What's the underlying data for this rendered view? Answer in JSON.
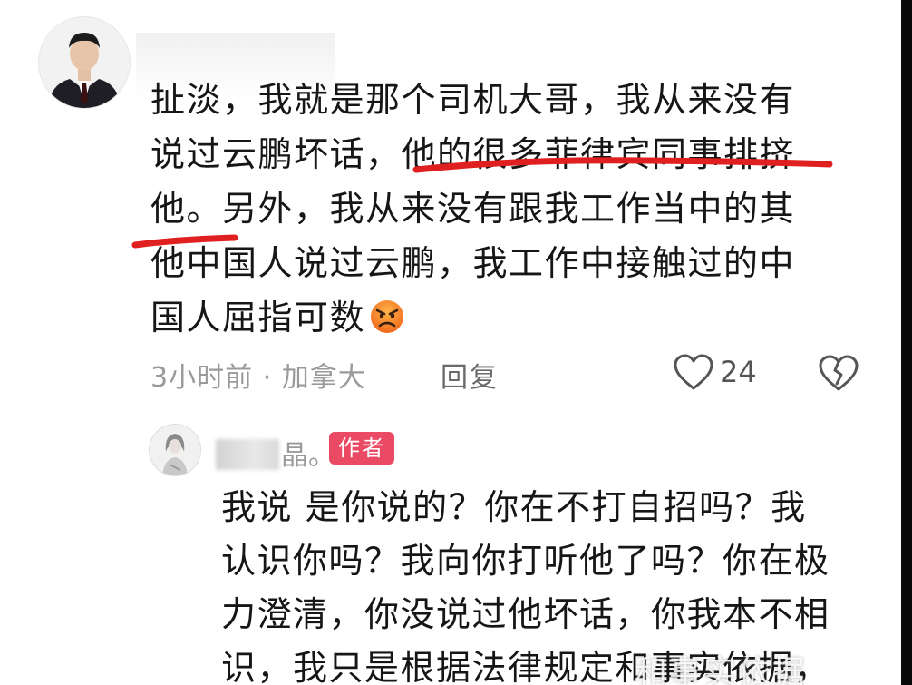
{
  "comment": {
    "lines": [
      "扯淡，我就是那个司机大哥，我从来没有",
      "说过云鹏坏话，他的很多菲律宾同事排挤",
      "他。另外，我从来没有跟我工作当中的其",
      "他中国人说过云鹏，我工作中接触过的中",
      "国人屈指可数"
    ],
    "emoji": "angry-face-emoji",
    "time_location": "3小时前 · 加拿大",
    "reply_label": "回复",
    "like_count": "24",
    "underline_color": "#e02020"
  },
  "reply": {
    "name_suffix": "晶。",
    "author_badge": "作者",
    "badge_color": "#ea4a63",
    "lines": [
      "我说 是你说的？你在不打自招吗？我",
      "认识你吗？我向你打听他了吗？你在极",
      "力澄清，你没说过他坏话，你我本不相",
      "识，我只是根据法律规定和事实依据，"
    ]
  },
  "watermark": "和事实依据"
}
